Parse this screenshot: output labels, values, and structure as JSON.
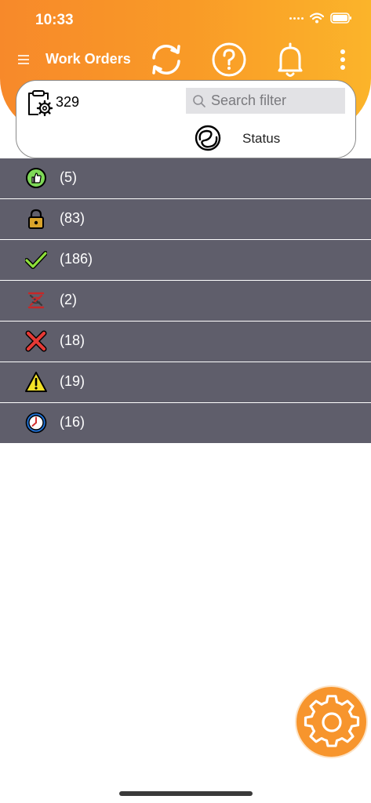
{
  "status_bar": {
    "time": "10:33"
  },
  "header": {
    "title": "Work Orders",
    "menu_icon": "hamburger-menu-icon",
    "actions": [
      "refresh-icon",
      "help-icon",
      "bell-icon",
      "more-vertical-icon"
    ],
    "gradient": [
      "#f7892a",
      "#fbb42a"
    ]
  },
  "filter_card": {
    "total_count": "329",
    "search_placeholder": "Search filter",
    "group_by_label": "Status"
  },
  "status_rows": [
    {
      "icon": "thumbs-up-icon",
      "label": "(5)"
    },
    {
      "icon": "lock-icon",
      "label": "(83)"
    },
    {
      "icon": "checkmark-icon",
      "label": "(186)"
    },
    {
      "icon": "broken-link-icon",
      "label": "(2)"
    },
    {
      "icon": "x-cancel-icon",
      "label": "(18)"
    },
    {
      "icon": "warning-icon",
      "label": "(19)"
    },
    {
      "icon": "clock-icon",
      "label": "(16)"
    }
  ],
  "colors": {
    "row_bg": "#5f5e6b",
    "accent": "#f7952d"
  },
  "fab_icon": "gear-icon"
}
